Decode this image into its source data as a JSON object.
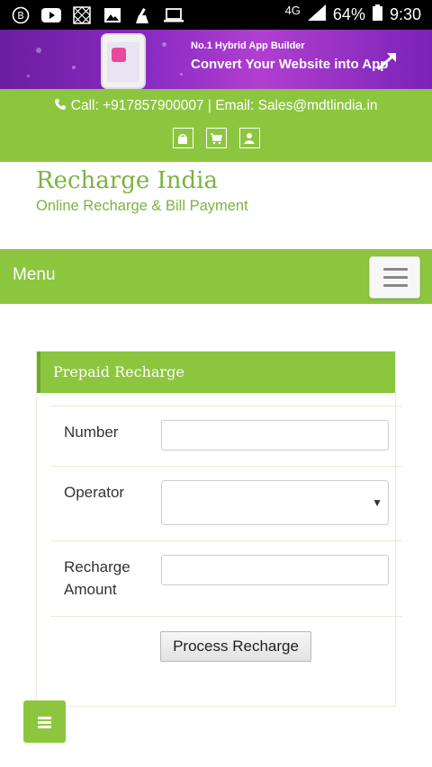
{
  "status_bar": {
    "left_icons": [
      "b-app-icon",
      "youtube-icon",
      "grid-app-icon",
      "image-icon",
      "cleaner-icon",
      "laptop-icon"
    ],
    "network": "4G",
    "battery": "64%",
    "time": "9:30"
  },
  "banner": {
    "line1": "No.1 Hybrid App Builder",
    "line2": "Convert Your Website into App"
  },
  "contact": {
    "text": "Call: +917857900007 | Email: Sales@mdtlindia.in",
    "icons": [
      "shopping-bag-icon",
      "cart-icon",
      "user-icon"
    ]
  },
  "site": {
    "title": "Recharge India",
    "tagline": "Online Recharge & Bill Payment"
  },
  "menu": {
    "label": "Menu"
  },
  "form": {
    "heading": "Prepaid Recharge",
    "number_label": "Number",
    "number_value": "",
    "operator_label": "Operator",
    "operator_value": "",
    "amount_label_1": "Recharge",
    "amount_label_2": "Amount",
    "amount_value": "",
    "submit_label": "Process Recharge"
  },
  "colors": {
    "accent_green": "#8cc63f",
    "title_green": "#7cb342",
    "banner_purple": "#8a2bc2"
  }
}
